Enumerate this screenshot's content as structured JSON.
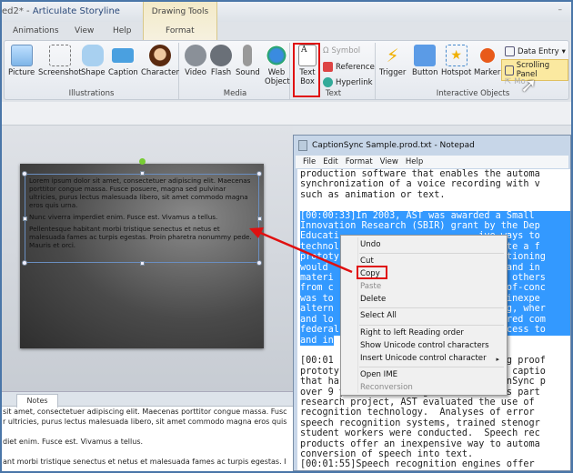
{
  "app": {
    "title_prefix": "ed2* - ",
    "title": "Articulate Storyline",
    "context_tab": "Drawing Tools",
    "minimize": "–"
  },
  "tabs": [
    "Animations",
    "View",
    "Help",
    "Format"
  ],
  "ribbon": {
    "illustrations": {
      "label": "Illustrations",
      "buttons": [
        "Picture",
        "Screenshot",
        "Shape",
        "Caption",
        "Character"
      ]
    },
    "media": {
      "label": "Media",
      "buttons": [
        "Video",
        "Flash",
        "Sound",
        "Web Object"
      ]
    },
    "text": {
      "label": "Text",
      "textbox": "Text Box",
      "small": [
        "Symbol",
        "Reference",
        "Hyperlink"
      ]
    },
    "interactive": {
      "label": "Interactive Objects",
      "buttons": [
        "Trigger",
        "Button",
        "Hotspot",
        "Marker"
      ],
      "small": [
        "Data Entry",
        "Scrolling Panel",
        "Mo"
      ]
    }
  },
  "slide": {
    "paragraphs": [
      "Lorem ipsum dolor sit amet, consectetuer adipiscing elit. Maecenas porttitor congue massa. Fusce posuere, magna sed pulvinar ultricies, purus lectus malesuada libero, sit amet commodo magna eros quis urna.",
      "Nunc viverra imperdiet enim. Fusce est. Vivamus a tellus.",
      "Pellentesque habitant morbi tristique senectus et netus et malesuada fames ac turpis egestas. Proin pharetra nonummy pede. Mauris et orci."
    ]
  },
  "notes": {
    "tab": "Notes",
    "lines": [
      "sit amet, consectetuer adipiscing elit. Maecenas porttitor congue massa. Fusc",
      "r ultricies, purus lectus malesuada libero, sit amet commodo magna eros quis",
      "",
      "diet enim. Fusce est. Vivamus a tellus.",
      "",
      "ant morbi tristique senectus et netus et malesuada fames ac turpis egestas. I"
    ]
  },
  "notepad": {
    "title": "CaptionSync Sample.prod.txt - Notepad",
    "menu": [
      "File",
      "Edit",
      "Format",
      "View",
      "Help"
    ],
    "lines_before": [
      "production software that enables the automa",
      "synchronization of a voice recording with v",
      "such as animation or text.",
      ""
    ],
    "lines_selected": [
      "[00:00:33]In 2003, AST was awarded a Small ",
      "Innovation Research (SBIR) grant by the Dep",
      "Educati                         ive ways to",
      "technol                          create a f",
      "prototy                           captioning",
      "would                           cast and in",
      "materi                            and others",
      "from c                           oof-of-conc",
      "was to                           and inexpe",
      "altern                           oning, wher",
      "and lo                           ampered com",
      "federal                          l access to",
      "and in"
    ],
    "lines_after": [
      "",
      "[00:01                           oning proof",
      "prototy                          ased captio",
      "that ha                          ptionSync p",
      "over 9 years of serving customers.  As part",
      "research project, AST evaluated the use of",
      "recognition technology.  Analyses of error",
      "speech recognition systems, trained stenogr",
      "student workers were conducted.  Speech rec",
      "products offer an inexpensive way to automa",
      "conversion of speech into text.",
      "[00:01:55]Speech recognition engines offer"
    ]
  },
  "context_menu": {
    "items": [
      {
        "label": "Undo",
        "disabled": false
      },
      {
        "label": "Cut",
        "disabled": false
      },
      {
        "label": "Copy",
        "disabled": false
      },
      {
        "label": "Paste",
        "disabled": true
      },
      {
        "label": "Delete",
        "disabled": false
      },
      {
        "label": "Select All",
        "disabled": false
      },
      {
        "label": "Right to left Reading order",
        "disabled": false
      },
      {
        "label": "Show Unicode control characters",
        "disabled": false
      },
      {
        "label": "Insert Unicode control character",
        "disabled": false,
        "submenu": true
      },
      {
        "label": "Open IME",
        "disabled": false
      },
      {
        "label": "Reconversion",
        "disabled": true
      }
    ]
  },
  "colors": {
    "highlight": "#e01010",
    "selection": "#3399ff"
  }
}
